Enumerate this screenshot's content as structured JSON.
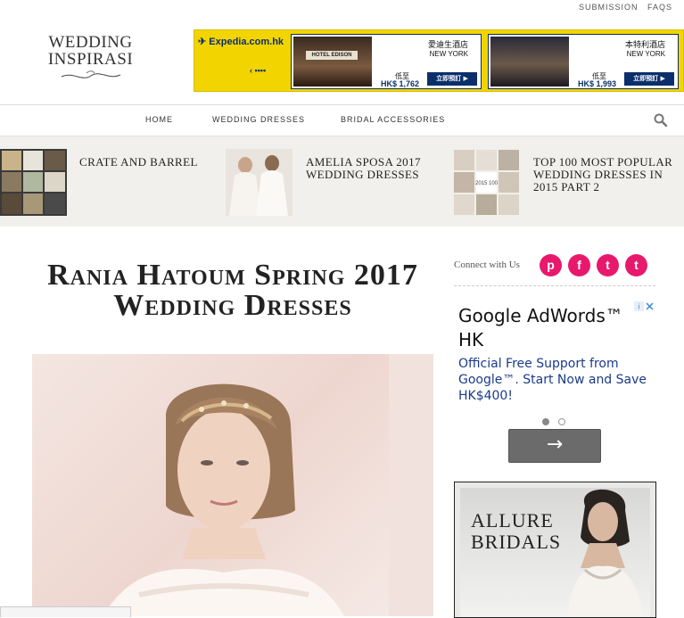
{
  "header": {
    "top_links": [
      "SUBMISSION",
      "FAQS"
    ],
    "logo_line1": "WEDDING",
    "logo_line2": "INSPIRASI"
  },
  "ad_banner": {
    "brand": "Expedia.com.hk",
    "arrows": "‹ ••••",
    "hotels": [
      {
        "name": "愛迪生酒店",
        "city": "NEW YORK",
        "low_label": "低至",
        "price": "HK$ 1,762",
        "book": "立即預訂",
        "sign": "HOTEL EDISON"
      },
      {
        "name": "本特利酒店",
        "city": "NEW YORK",
        "low_label": "低至",
        "price": "HK$ 1,993",
        "book": "立即預訂"
      }
    ]
  },
  "nav": {
    "items": [
      "HOME",
      "WEDDING DRESSES",
      "BRIDAL ACCESSORIES"
    ],
    "search_icon": "search-icon"
  },
  "featured": [
    {
      "title": "Crate and Barrel"
    },
    {
      "title": "Amelia Sposa 2017 Wedding Dresses"
    },
    {
      "title": "Top 100 Most Popular Wedding Dresses in 2015 Part 2",
      "thumb_text": "2015 100"
    }
  ],
  "article": {
    "title": "Rania Hatoum Spring 2017 Wedding Dresses"
  },
  "sidebar": {
    "connect_label": "Connect with Us",
    "social": [
      {
        "icon": "pinterest-icon",
        "glyph": "p"
      },
      {
        "icon": "facebook-icon",
        "glyph": "f"
      },
      {
        "icon": "twitter-icon",
        "glyph": "t"
      },
      {
        "icon": "tumblr-icon",
        "glyph": "t"
      }
    ],
    "google_ad": {
      "title": "Google AdWords™ HK",
      "body": "Official Free Support from Google™. Start Now and Save HK$400!",
      "next_glyph": "→"
    },
    "allure_ad": {
      "line1": "ALLURE",
      "line2": "BRIDALS"
    }
  },
  "colors": {
    "social_pink": "#e8186d",
    "ad_yellow": "#f2d400",
    "ad_navy": "#0b2f6b",
    "featured_bg": "#f1f0ed"
  }
}
